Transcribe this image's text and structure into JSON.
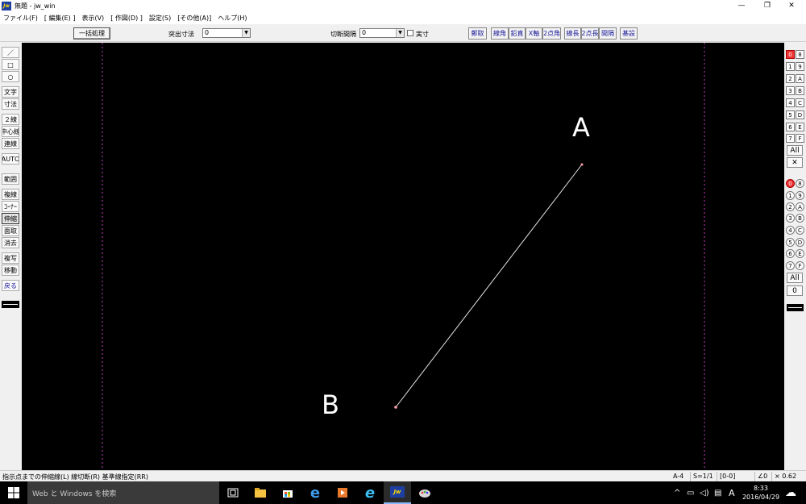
{
  "window": {
    "title": "無題 - jw_win",
    "logo_text": "Jw"
  },
  "menu": [
    "ファイル(F)",
    "[ 編集(E) ]",
    "表示(V)",
    "[ 作図(D) ]",
    "設定(S)",
    "[その他(A)]",
    "ヘルプ(H)"
  ],
  "toolbar": {
    "batch_label": "一括処理",
    "protrude_label": "突出寸法",
    "protrude_value": "0",
    "cut_interval_label": "切断間隔",
    "cut_interval_value": "0",
    "actual_size_label": "実寸",
    "buttons": [
      "鄭取",
      "線角",
      "鉛直",
      "X軸",
      "2点角",
      "線長",
      "2点長",
      "間隔",
      "基設"
    ]
  },
  "left_palette": [
    "／",
    "□",
    "○",
    "文字",
    "寸法",
    "２線",
    "中心線",
    "連線",
    "AUTO",
    "範囲",
    "複線",
    "ｺｰﾅｰ",
    "伸縮",
    "面取",
    "消去",
    "複写",
    "移動",
    "戻る"
  ],
  "right_palette": {
    "layer_groups": [
      [
        "0",
        "8"
      ],
      [
        "1",
        "9"
      ],
      [
        "2",
        "A"
      ],
      [
        "3",
        "B"
      ],
      [
        "4",
        "C"
      ],
      [
        "5",
        "D"
      ],
      [
        "6",
        "E"
      ],
      [
        "7",
        "F"
      ]
    ],
    "all_label": "All",
    "x_label": "✕",
    "layers": [
      [
        "0",
        "8"
      ],
      [
        "1",
        "9"
      ],
      [
        "2",
        "A"
      ],
      [
        "3",
        "B"
      ],
      [
        "4",
        "C"
      ],
      [
        "5",
        "D"
      ],
      [
        "6",
        "E"
      ],
      [
        "7",
        "F"
      ]
    ],
    "all2_label": "All",
    "zero_label": "0"
  },
  "canvas": {
    "point_a_label": "A",
    "point_b_label": "B",
    "line_color": "#e6e6e6",
    "guide_color": "#c03cc0"
  },
  "status": {
    "hint": "指示点までの伸縮線(L)  線切断(R)  基準線指定(RR)",
    "paper": "A-4",
    "scale": "S=1/1",
    "layer": "[0-0]",
    "angle": "∠0",
    "zoom": "× 0.62"
  },
  "taskbar": {
    "search_placeholder": "Web と Windows を検索",
    "time": "8:33",
    "date": "2016/04/29",
    "ime": "A"
  }
}
